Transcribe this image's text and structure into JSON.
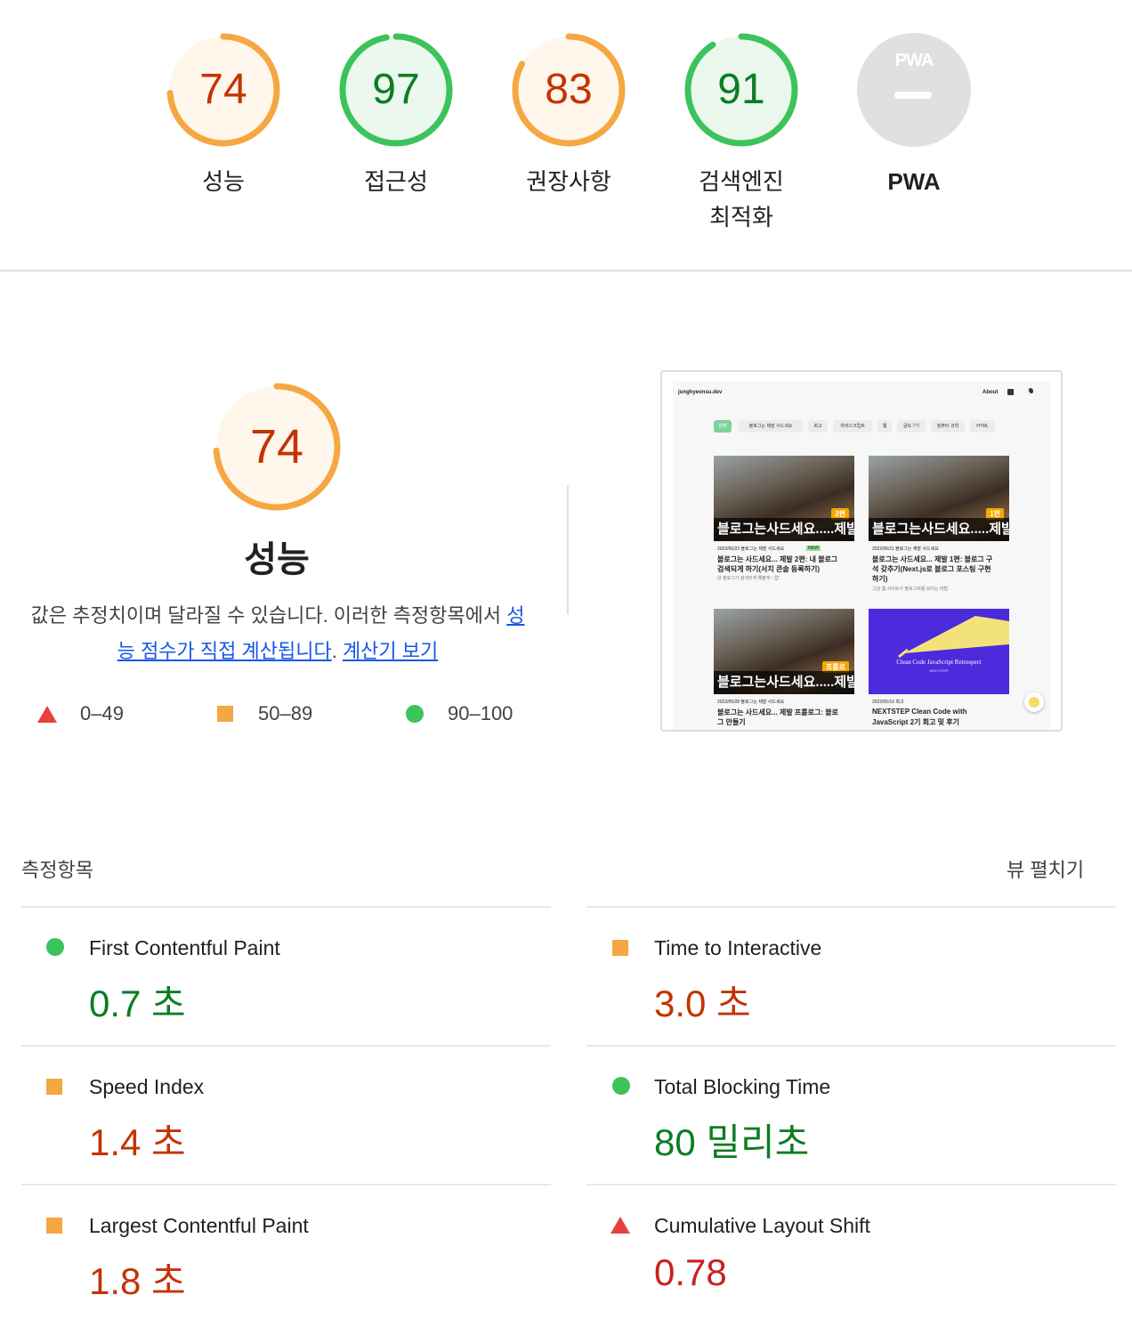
{
  "categories": [
    {
      "id": "performance",
      "score": "74",
      "label": "성능",
      "status": "average"
    },
    {
      "id": "accessibility",
      "score": "97",
      "label": "접근성",
      "status": "pass"
    },
    {
      "id": "best_practices",
      "score": "83",
      "label": "권장사항",
      "status": "average"
    },
    {
      "id": "seo",
      "score": "91",
      "label": "검색엔진",
      "label2": "최적화",
      "status": "pass"
    },
    {
      "id": "pwa",
      "score": "",
      "label": "PWA",
      "badge": "PWA",
      "status": "na"
    }
  ],
  "perf": {
    "score": "74",
    "title": "성능",
    "desc_pre": "값은 추정치이며 달라질 수 있습니다. 이러한 측정항목에서 ",
    "desc_link1a": "성",
    "desc_link1b": "능 점수가 직접 계산됩니다",
    "desc_sep": ". ",
    "desc_link2": "계산기 보기",
    "legend": [
      {
        "icon": "fail-triangle-icon",
        "range": "0–49"
      },
      {
        "icon": "average-square-icon",
        "range": "50–89"
      },
      {
        "icon": "pass-circle-icon",
        "range": "90–100"
      }
    ]
  },
  "screenshot": {
    "site": "junghyeonsu.dev",
    "nav_about": "About",
    "chips": [
      "전체",
      "블로그는 제발 사드세요",
      "회고",
      "자바스크립트",
      "웹",
      "글또 7기",
      "컴퓨터 과학",
      "HTML"
    ],
    "posts": [
      {
        "band": "블로그는사드세요.....제발",
        "tag": "2편",
        "date": "2022/06/23  블로그는 제발 사드세요",
        "new": "NEW",
        "title1": "블로그는 사드세요... 제발 2편: 내 블로그",
        "title2": "검색되게 하기(서치 콘솔 등록하기)",
        "sub": "내 블로그가 검색되게 해볼게~ 업!"
      },
      {
        "band": "블로그는사드세요.....제발",
        "tag": "1편",
        "date": "2022/06/11  블로그는 제발 사드세요",
        "title1": "블로그는 사드세요... 제발 1편: 블로그 구",
        "title2": "석 갖추기(Next.js로 블로그 포스팅 구현",
        "title3": "하기)",
        "sub": "그냥 웹 사이트가 블로그처럼 보이는 마법"
      },
      {
        "band": "블로그는사드세요.....제발",
        "tag": "프롤로",
        "date": "2022/05/28  블로그는 제발 사드세요",
        "title1": "블로그는 사드세요... 제발 프롤로그: 블로",
        "title2": "그 만들기"
      },
      {
        "band": "Clean Code JavaScript Retrospect",
        "sub_band": "NEXTSTEP",
        "date": "2022/05/10  회고",
        "title1": "NEXTSTEP Clean Code with",
        "title2": "JavaScript 2기 회고 및 후기"
      }
    ]
  },
  "metrics_header": {
    "title": "측정항목",
    "expand": "뷰 펼치기"
  },
  "metrics": [
    {
      "name": "First Contentful Paint",
      "value": "0.7 초",
      "status": "pass"
    },
    {
      "name": "Time to Interactive",
      "value": "3.0 초",
      "status": "average"
    },
    {
      "name": "Speed Index",
      "value": "1.4 초",
      "status": "average"
    },
    {
      "name": "Total Blocking Time",
      "value": "80 밀리초",
      "status": "pass"
    },
    {
      "name": "Largest Contentful Paint",
      "value": "1.8 초",
      "status": "average"
    },
    {
      "name": "Cumulative Layout Shift",
      "value": "0.78",
      "status": "fail"
    }
  ],
  "colors": {
    "pass": "#0c7d23",
    "average": "#c33300",
    "fail": "#c7221f",
    "passRing": "#3cc35c",
    "averageRing": "#f5a742",
    "passFill": "#eaf8ee",
    "averageFill": "#fff6ec"
  }
}
